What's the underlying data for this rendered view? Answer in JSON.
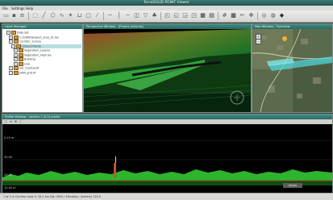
{
  "app": {
    "title": "TerraSOLID POINT Viewer"
  },
  "menu": [
    "File",
    "Settings",
    "Help"
  ],
  "toolbar": {
    "icons": [
      "open-folder-icon",
      "save-icon",
      "layers-icon",
      "select-icon",
      "ruler-icon",
      "polygon-icon",
      "polyline-icon",
      "point-icon",
      "section-icon",
      "zoom-extent-icon",
      "magic-wand-icon",
      "horizontal-line-icon",
      "vertical-line-icon",
      "level-icon",
      "color-icon",
      "filter-icon",
      "tree-icon",
      "view-icon",
      "classify-icon",
      "region-icon",
      "surface-icon",
      "sat-icon",
      "ortho-icon",
      "tiles-icon"
    ]
  },
  "tree": {
    "title": "Layer Manager",
    "rows": [
      {
        "label": "Data Set",
        "indent": 1,
        "sel": false
      },
      {
        "label": "C:/LiDAR/project_area_01.las",
        "indent": 2,
        "sel": false
      },
      {
        "label": "Corridor_Survey",
        "indent": 2,
        "sel": false
      },
      {
        "label": "Ground Points",
        "indent": 3,
        "sel": true
      },
      {
        "label": "Vegetation_Low.las",
        "indent": 4,
        "sel": false
      },
      {
        "label": "Vegetation_High.las",
        "indent": 4,
        "sel": false
      },
      {
        "label": "Building",
        "indent": 4,
        "sel": false
      },
      {
        "label": "Line",
        "indent": 4,
        "sel": false
      },
      {
        "label": "Sat_Overlay.tif",
        "indent": 2,
        "sel": false
      },
      {
        "label": "DEM_grid.tif",
        "indent": 2,
        "sel": false
      }
    ]
  },
  "view3d": {
    "title": "Perspective Window - [Project_area.las]"
  },
  "map": {
    "title": "Map Window - Overview"
  },
  "profile": {
    "title": "Profile Window - section 1 (0.5) profile",
    "y_labels": [
      "0.25 m",
      "30.00",
      "20.00",
      "10.00 m"
    ],
    "zoom_text": "Zoom"
  },
  "status": {
    "text": "1 of 4 in Corridor area   X: 34.2 km   Sat: 0000 / Elevation: (meters) 124.0"
  },
  "colors": {
    "accent": "#2c6a63",
    "ground": "#1c8b1c",
    "canopy": "#34c234",
    "terrain": "#a5432a"
  }
}
